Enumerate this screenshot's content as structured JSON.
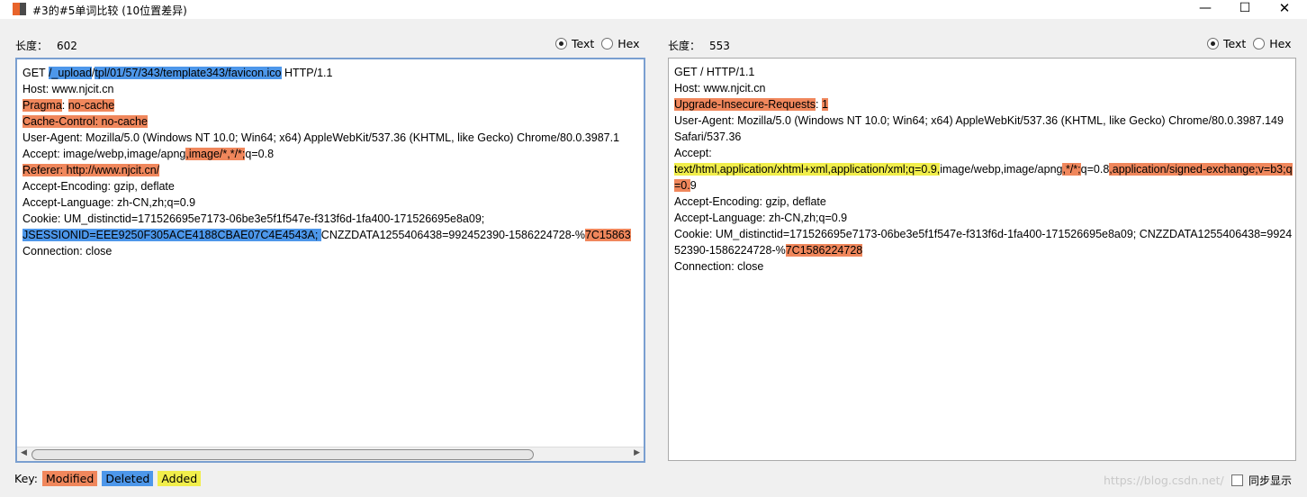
{
  "window": {
    "title": "#3的#5单词比较  (10位置差异)",
    "controls": {
      "minimize": "—",
      "maximize": "☐",
      "close": "✕"
    }
  },
  "left": {
    "length_label": "长度：",
    "length_value": "602",
    "view_options": [
      {
        "label": "Text",
        "selected": true
      },
      {
        "label": "Hex",
        "selected": false
      }
    ],
    "lines": [
      [
        {
          "t": "GET "
        },
        {
          "t": "/_upload",
          "h": "d"
        },
        {
          "t": "/"
        },
        {
          "t": "tpl/01/57/343/template343/favicon.ico",
          "h": "d"
        },
        {
          "t": " HTTP/1.1"
        }
      ],
      [
        {
          "t": "Host: www.njcit.cn"
        }
      ],
      [
        {
          "t": "Pragma",
          "h": "m"
        },
        {
          "t": ": "
        },
        {
          "t": "no-cache",
          "h": "m"
        }
      ],
      [
        {
          "t": "Cache-Control: no-cache",
          "h": "m"
        }
      ],
      [
        {
          "t": "User-Agent: Mozilla/5.0 (Windows NT 10.0; Win64; x64) AppleWebKit/537.36 (KHTML, like Gecko) Chrome/80.0.3987.1"
        }
      ],
      [
        {
          "t": "Accept: image/webp,image/apng"
        },
        {
          "t": ",image/*,*/*;",
          "h": "m"
        },
        {
          "t": "q=0.8"
        }
      ],
      [
        {
          "t": "Referer: http://www.njcit.cn/",
          "h": "m"
        }
      ],
      [
        {
          "t": "Accept-Encoding: gzip, deflate"
        }
      ],
      [
        {
          "t": "Accept-Language: zh-CN,zh;q=0.9"
        }
      ],
      [
        {
          "t": "Cookie: UM_distinctid=171526695e7173-06be3e5f1f547e-f313f6d-1fa400-171526695e8a09;"
        }
      ],
      [
        {
          "t": "JSESSIONID=EEE9250F305ACE4188CBAE07C4E4543A; ",
          "h": "d"
        },
        {
          "t": "CNZZDATA1255406438=992452390-1586224728-%"
        },
        {
          "t": "7C15863",
          "h": "m"
        }
      ],
      [
        {
          "t": "Connection: close"
        }
      ]
    ]
  },
  "right": {
    "length_label": "长度：",
    "length_value": "553",
    "view_options": [
      {
        "label": "Text",
        "selected": true
      },
      {
        "label": "Hex",
        "selected": false
      }
    ],
    "lines": [
      [
        {
          "t": "GET / HTTP/1.1"
        }
      ],
      [
        {
          "t": "Host: www.njcit.cn"
        }
      ],
      [
        {
          "t": "Upgrade-Insecure-Requests",
          "h": "m"
        },
        {
          "t": ": "
        },
        {
          "t": "1",
          "h": "m"
        }
      ],
      [
        {
          "t": "User-Agent: Mozilla/5.0 (Windows NT 10.0; Win64; x64) AppleWebKit/537.36 (KHTML, like Gecko) Chrome/80.0.3987.149 Safari/537.36"
        }
      ],
      [
        {
          "t": "Accept:"
        }
      ],
      [
        {
          "t": "text/html,application/xhtml+xml,application/xml;q=0.9,",
          "h": "a"
        },
        {
          "t": "image/webp,image/apng"
        },
        {
          "t": ",*/*;",
          "h": "m"
        },
        {
          "t": "q=0.8"
        },
        {
          "t": ",application/signed-exchange;v=b3;q=0.",
          "h": "m"
        },
        {
          "t": "9"
        }
      ],
      [
        {
          "t": "Accept-Encoding: gzip, deflate"
        }
      ],
      [
        {
          "t": "Accept-Language: zh-CN,zh;q=0.9"
        }
      ],
      [
        {
          "t": "Cookie: UM_distinctid=171526695e7173-06be3e5f1f547e-f313f6d-1fa400-171526695e8a09; CNZZDATA1255406438=992452390-1586224728-%"
        },
        {
          "t": "7C1586224728",
          "h": "m"
        }
      ],
      [
        {
          "t": "Connection: close"
        }
      ]
    ]
  },
  "key": {
    "label": "Key:",
    "items": [
      {
        "label": "Modified",
        "color": "#f0875c"
      },
      {
        "label": "Deleted",
        "color": "#4d97ea"
      },
      {
        "label": "Added",
        "color": "#f1ee4b"
      }
    ]
  },
  "sync": {
    "label": "同步显示",
    "checked": false
  },
  "watermark": "https://blog.csdn.net/"
}
